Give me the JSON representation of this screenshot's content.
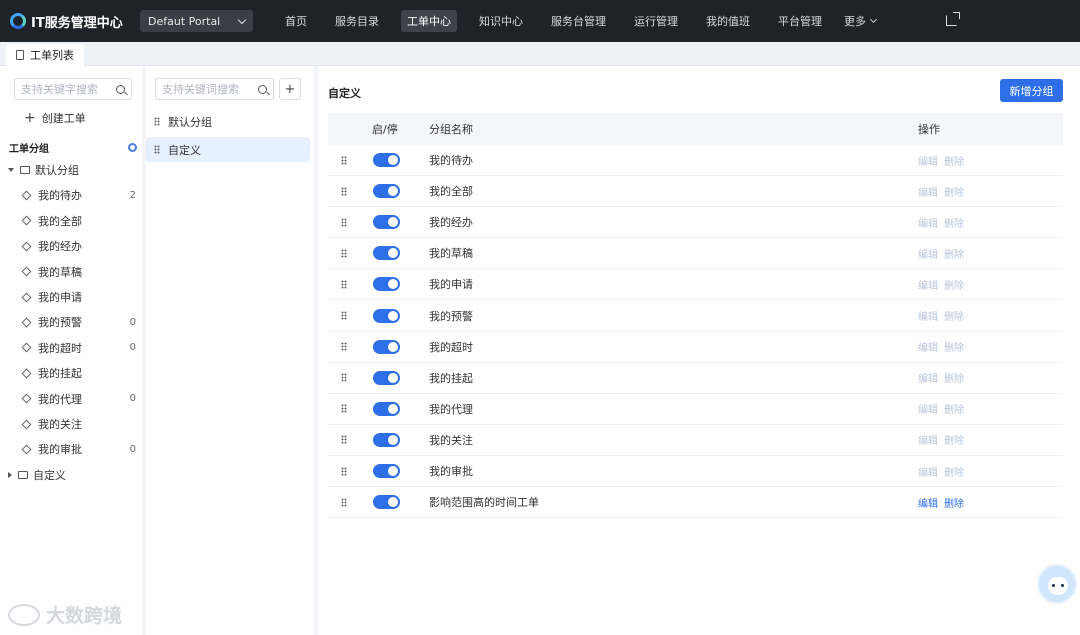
{
  "app": {
    "title": "IT服务管理中心"
  },
  "portal": {
    "selected": "Defaut Portal"
  },
  "nav": {
    "items": [
      "首页",
      "服务目录",
      "工单中心",
      "知识中心",
      "服务台管理",
      "运行管理",
      "我的值班",
      "平台管理"
    ],
    "active_index": 2,
    "more_label": "更多"
  },
  "tabs": [
    {
      "label": "工单列表"
    }
  ],
  "sidebar": {
    "search_placeholder": "支持关键字搜索",
    "create_label": "创建工单",
    "group_header": "工单分组",
    "folders": [
      {
        "label": "默认分组",
        "expanded": true,
        "items": [
          {
            "label": "我的待办",
            "count": "2"
          },
          {
            "label": "我的全部",
            "count": ""
          },
          {
            "label": "我的经办",
            "count": ""
          },
          {
            "label": "我的草稿",
            "count": ""
          },
          {
            "label": "我的申请",
            "count": ""
          },
          {
            "label": "我的预警",
            "count": "0"
          },
          {
            "label": "我的超时",
            "count": "0"
          },
          {
            "label": "我的挂起",
            "count": ""
          },
          {
            "label": "我的代理",
            "count": "0"
          },
          {
            "label": "我的关注",
            "count": ""
          },
          {
            "label": "我的审批",
            "count": "0"
          }
        ]
      },
      {
        "label": "自定义",
        "expanded": false,
        "items": []
      }
    ]
  },
  "groups_panel": {
    "search_placeholder": "支持关键词搜索",
    "add_label": "+",
    "items": [
      {
        "label": "默认分组",
        "active": false
      },
      {
        "label": "自定义",
        "active": true
      }
    ]
  },
  "main": {
    "title": "自定义",
    "add_button": "新增分组",
    "columns": {
      "status": "启/停",
      "name": "分组名称",
      "ops": "操作"
    },
    "op_labels": {
      "edit": "编辑",
      "delete": "删除"
    },
    "rows": [
      {
        "name": "我的待办",
        "enabled": true,
        "editable": false
      },
      {
        "name": "我的全部",
        "enabled": true,
        "editable": false
      },
      {
        "name": "我的经办",
        "enabled": true,
        "editable": false
      },
      {
        "name": "我的草稿",
        "enabled": true,
        "editable": false
      },
      {
        "name": "我的申请",
        "enabled": true,
        "editable": false
      },
      {
        "name": "我的预警",
        "enabled": true,
        "editable": false
      },
      {
        "name": "我的超时",
        "enabled": true,
        "editable": false
      },
      {
        "name": "我的挂起",
        "enabled": true,
        "editable": false
      },
      {
        "name": "我的代理",
        "enabled": true,
        "editable": false
      },
      {
        "name": "我的关注",
        "enabled": true,
        "editable": false
      },
      {
        "name": "我的审批",
        "enabled": true,
        "editable": false
      },
      {
        "name": "影响范围高的时间工单",
        "enabled": true,
        "editable": true
      }
    ]
  },
  "watermark": {
    "text": "大数跨境"
  },
  "colors": {
    "topbar": "#1f2228",
    "primary": "#2e6ee6",
    "muted_link": "#b8c6da",
    "active_group": "#e6f0fd"
  },
  "icons": {
    "logo": "logo-icon",
    "external": "external-link-icon",
    "search": "search-icon",
    "gear": "gear-icon",
    "folder": "folder-icon",
    "layers": "layers-icon",
    "drag": "drag-handle-icon",
    "mascot": "assistant-mascot-icon"
  }
}
